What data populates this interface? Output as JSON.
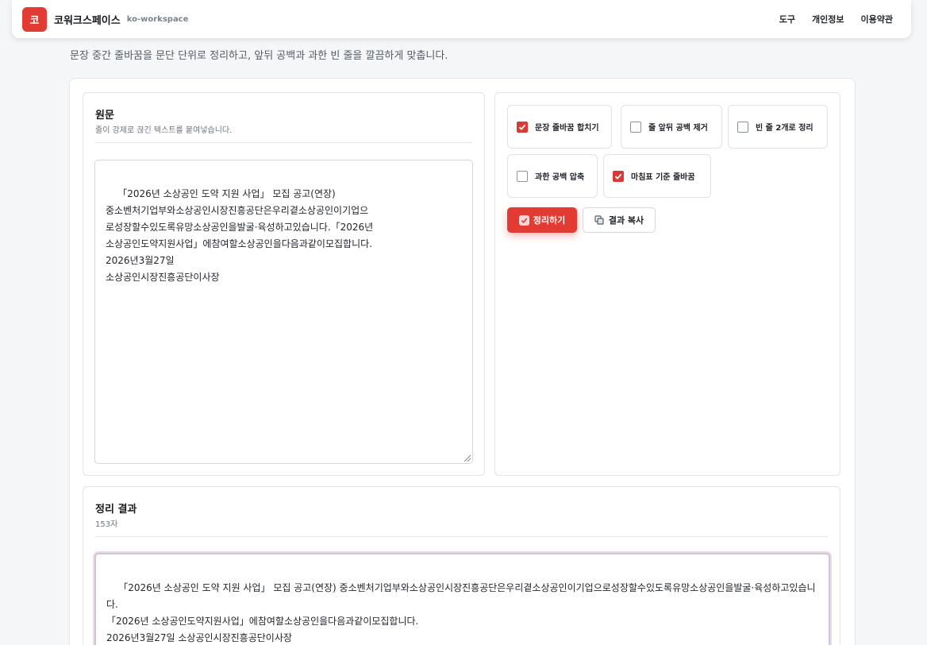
{
  "header": {
    "logo_char": "코",
    "brand": "코워크스페이스",
    "brand_sub": "ko-workspace",
    "nav": [
      "도구",
      "개인정보",
      "이용약관"
    ]
  },
  "page": {
    "subtitle": "문장 중간 줄바꿈을 문단 단위로 정리하고, 앞뒤 공백과 과한 빈 줄을 깔끔하게 맞춥니다."
  },
  "input_panel": {
    "title": "원문",
    "description": "줄이 강제로 끊긴 텍스트를 붙여넣습니다.",
    "value": "「2026년 소상공인 도약 지원 사업」 모집 공고(연장)\n중소벤처기업부와소상공인시장진흥공단은우리곁소상공인이기업으\n로성장할수있도록유망소상공인을발굴·육성하고있습니다.「2026년\n소상공인도약지원사업」에참여할소상공인을다음과같이모집합니다.\n2026년3월27일\n소상공인시장진흥공단이사장"
  },
  "options": [
    {
      "label": "문장 줄바꿈 합치기",
      "checked": true
    },
    {
      "label": "줄 앞뒤 공백 제거",
      "checked": false
    },
    {
      "label": "빈 줄 2개로 정리",
      "checked": false
    },
    {
      "label": "과한 공백 압축",
      "checked": false
    },
    {
      "label": "마침표 기준 줄바꿈",
      "checked": true
    }
  ],
  "actions": {
    "clean_label": "정리하기",
    "copy_label": "결과 복사"
  },
  "result_panel": {
    "title": "정리 결과",
    "count": "153자",
    "value": "「2026년 소상공인 도약 지원 사업」 모집 공고(연장) 중소벤처기업부와소상공인시장진흥공단은우리곁소상공인이기업으로성장할수있도록유망소상공인을발굴·육성하고있습니다.\n「2026년 소상공인도약지원사업」에참여할소상공인을다음과같이모집합니다.\n2026년3월27일 소상공인시장진흥공단이사장"
  },
  "colors": {
    "accent": "#e23b34",
    "background": "#f5f6f8"
  }
}
